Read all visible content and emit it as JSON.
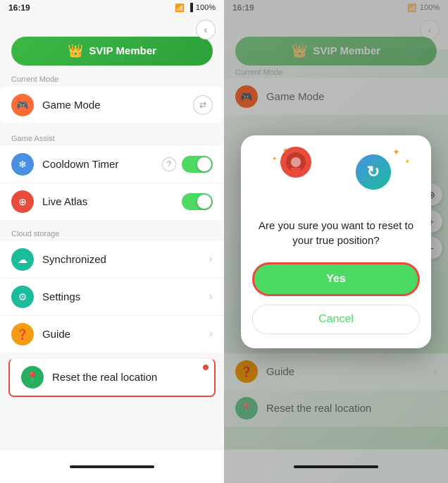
{
  "app": {
    "status_time": "16:19",
    "battery": "100%"
  },
  "left_panel": {
    "svip_label": "SVIP Member",
    "current_mode_label": "Current Mode",
    "game_mode_label": "Game Mode",
    "game_assist_label": "Game Assist",
    "cooldown_timer_label": "Cooldown Timer",
    "live_atlas_label": "Live Atlas",
    "cloud_storage_label": "Cloud storage",
    "synchronized_label": "Synchronized",
    "settings_label": "Settings",
    "guide_label": "Guide",
    "reset_location_label": "Reset the real location",
    "back_label": "‹"
  },
  "dialog": {
    "question": "Are you sure you want to reset to your true position?",
    "yes_label": "Yes",
    "cancel_label": "Cancel"
  },
  "right_panel": {
    "current_mode_label": "Current Mode",
    "game_mode_label": "Game Mode",
    "game_assist_label": "Game Assist",
    "svip_label": "SVIP Member",
    "guide_label": "Guide",
    "reset_location_label": "Reset the real location"
  }
}
